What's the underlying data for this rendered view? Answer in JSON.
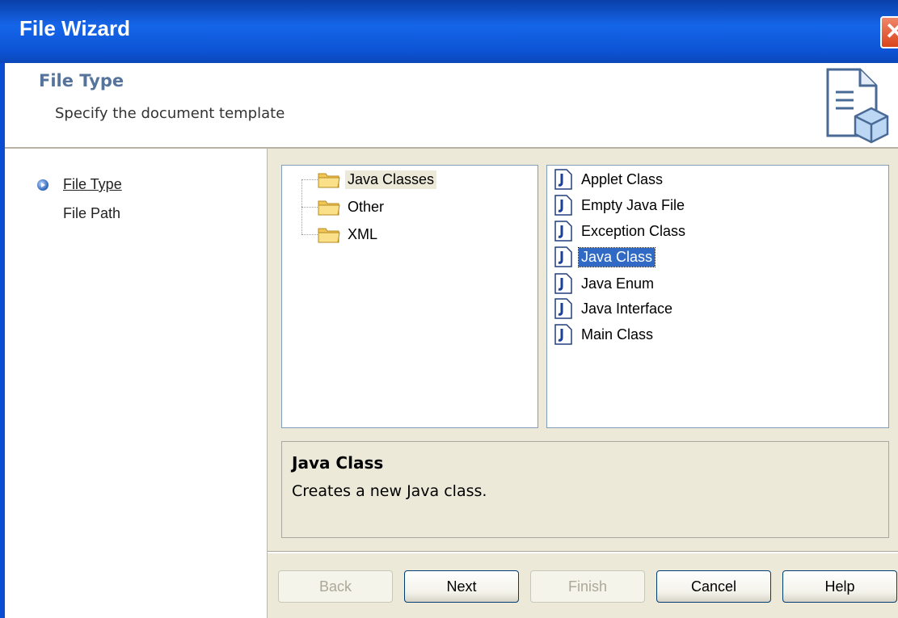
{
  "window": {
    "title": "File Wizard",
    "close_glyph": "✕"
  },
  "header": {
    "title": "File Type",
    "subtitle": "Specify the document template",
    "icon": "document-template-icon"
  },
  "steps": [
    {
      "label": "File Type",
      "current": true
    },
    {
      "label": "File Path",
      "current": false
    }
  ],
  "categories": [
    {
      "label": "Java Classes",
      "selected": true
    },
    {
      "label": "Other",
      "selected": false
    },
    {
      "label": "XML",
      "selected": false
    }
  ],
  "templates": [
    {
      "label": "Applet Class",
      "selected": false
    },
    {
      "label": "Empty Java File",
      "selected": false
    },
    {
      "label": "Exception Class",
      "selected": false
    },
    {
      "label": "Java Class",
      "selected": true
    },
    {
      "label": "Java Enum",
      "selected": false
    },
    {
      "label": "Java Interface",
      "selected": false
    },
    {
      "label": "Main Class",
      "selected": false
    }
  ],
  "description": {
    "title": "Java Class",
    "text": "Creates a new Java class."
  },
  "buttons": {
    "back": {
      "label": "Back",
      "enabled": false
    },
    "next": {
      "label": "Next",
      "enabled": true
    },
    "finish": {
      "label": "Finish",
      "enabled": false
    },
    "cancel": {
      "label": "Cancel",
      "enabled": true
    },
    "help": {
      "label": "Help",
      "enabled": true
    }
  },
  "colors": {
    "titlebar": "#0d54d6",
    "selection": "#316ac5",
    "panel": "#ece9d8",
    "header_title": "#56749b"
  }
}
